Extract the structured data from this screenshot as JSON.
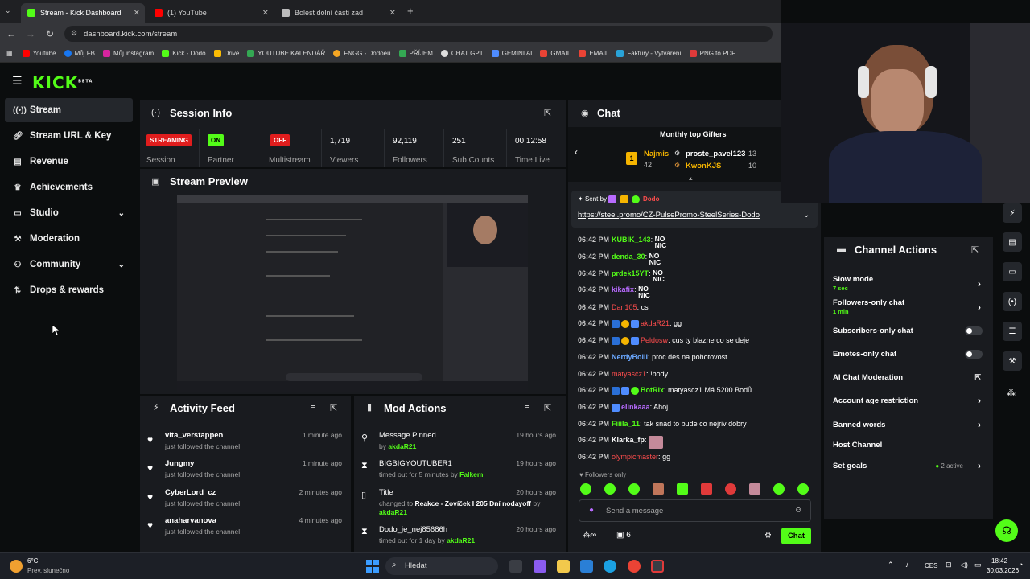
{
  "browser": {
    "tabs": [
      {
        "title": "Stream - Kick Dashboard",
        "active": true
      },
      {
        "title": "(1) YouTube",
        "active": false
      },
      {
        "title": "Bolest dolní části zad",
        "active": false
      }
    ],
    "new_tab": "+",
    "url": "dashboard.kick.com/stream",
    "bookmarks": [
      "Youtube",
      "Můj FB",
      "Můj instagram",
      "Kick - Dodo",
      "Drive",
      "YOUTUBE KALENDÁŘ",
      "FNGG - Dodoeu",
      "PŘÍJEM",
      "CHAT GPT",
      "GEMINI AI",
      "GMAIL",
      "EMAIL",
      "Faktury - Vytváření",
      "PNG to PDF"
    ]
  },
  "kick": {
    "logo": "KICK",
    "logo_sup": "BETA",
    "brand_color": "#53fc18"
  },
  "sidebar": {
    "items": [
      {
        "label": "Stream",
        "icon": "broadcast-icon"
      },
      {
        "label": "Stream URL & Key",
        "icon": "link-icon"
      },
      {
        "label": "Revenue",
        "icon": "chart-icon"
      },
      {
        "label": "Achievements",
        "icon": "trophy-icon"
      },
      {
        "label": "Studio",
        "icon": "monitor-icon"
      },
      {
        "label": "Moderation",
        "icon": "wrench-icon"
      },
      {
        "label": "Community",
        "icon": "people-icon"
      },
      {
        "label": "Drops & rewards",
        "icon": "gift-icon"
      }
    ]
  },
  "session": {
    "title": "Session Info",
    "stats": [
      {
        "badge": "STREAMING",
        "label": "Session"
      },
      {
        "badge": "ON",
        "label": "Partner"
      },
      {
        "badge": "OFF",
        "label": "Multistream"
      },
      {
        "value": "1,719",
        "label": "Viewers"
      },
      {
        "value": "92,119",
        "label": "Followers"
      },
      {
        "value": "251",
        "label": "Sub Counts"
      },
      {
        "value": "00:12:58",
        "label": "Time Live"
      }
    ]
  },
  "preview": {
    "title": "Stream Preview"
  },
  "activity": {
    "title": "Activity Feed",
    "items": [
      {
        "name": "vita_verstappen",
        "sub": "just followed the channel",
        "time": "1 minute ago"
      },
      {
        "name": "Jungmy",
        "sub": "just followed the channel",
        "time": "1 minute ago"
      },
      {
        "name": "CyberLord_cz",
        "sub": "just followed the channel",
        "time": "2 minutes ago"
      },
      {
        "name": "anaharvanova",
        "sub": "just followed the channel",
        "time": "4 minutes ago"
      }
    ]
  },
  "mod": {
    "title": "Mod Actions",
    "items": [
      {
        "name": "Message Pinned",
        "pre": "by",
        "by": "akdaR21",
        "time": "19 hours ago"
      },
      {
        "name": "BIGBIGYOUTUBER1",
        "pre": "timed out for 5 minutes by",
        "by": "Falkem",
        "time": "19 hours ago"
      },
      {
        "name": "Title",
        "pre": "changed to",
        "mid": "Reakce - Zovíček I 205 Dní nodayoff",
        "pre2": "by",
        "by": "akdaR21",
        "time": "20 hours ago"
      },
      {
        "name": "Dodo_je_nej85686h",
        "pre": "timed out for 1 day by",
        "by": "akdaR21",
        "time": "20 hours ago"
      }
    ]
  },
  "chat": {
    "title": "Chat",
    "gifters_title": "Monthly top Gifters",
    "gifters": [
      {
        "rank": "1",
        "name": "Najmis",
        "count": "42"
      },
      {
        "name": "proste_pavel123",
        "count": "13"
      },
      {
        "name": "KwonKJS",
        "count": "10"
      }
    ],
    "pinned_by_label": "Sent by",
    "pinned_by": "Dodo",
    "pinned_link": "https://steel.promo/CZ-PulsePromo-SteelSeries-Dodo",
    "messages": [
      {
        "time": "06:42 PM",
        "user": "KUBIK_143",
        "color": "#53fc18",
        "text": "NO NIC"
      },
      {
        "time": "06:42 PM",
        "user": "denda_30",
        "color": "#53fc18",
        "text": "NO NIC"
      },
      {
        "time": "06:42 PM",
        "user": "prdek15YT",
        "color": "#53fc18",
        "text": "NO NIC"
      },
      {
        "time": "06:42 PM",
        "user": "kikafix",
        "color": "#b86bff",
        "text": "NO NIC"
      },
      {
        "time": "06:42 PM",
        "user": "Dan105",
        "color": "#ff4d4d",
        "text": "cs"
      },
      {
        "time": "06:42 PM",
        "user": "akdaR21",
        "color": "#ff4d4d",
        "text": "gg"
      },
      {
        "time": "06:42 PM",
        "user": "Peldosw",
        "color": "#ff4d4d",
        "text": "cus ty blazne co se deje"
      },
      {
        "time": "06:42 PM",
        "user": "NerdyBoiii",
        "color": "#6ba8ff",
        "text": "proc des na pohotovost"
      },
      {
        "time": "06:42 PM",
        "user": "matyascz1",
        "color": "#ff4d4d",
        "text": "!body"
      },
      {
        "time": "06:42 PM",
        "user": "BotRix",
        "color": "#53fc18",
        "text": "matyascz1 Má 5200 Bodů"
      },
      {
        "time": "06:42 PM",
        "user": "elinkaaa",
        "color": "#b86bff",
        "text": "Ahoj"
      },
      {
        "time": "06:42 PM",
        "user": "Fiiila_11",
        "color": "#53fc18",
        "text": "tak snad to bude co nejriv dobry"
      },
      {
        "time": "06:42 PM",
        "user": "Klarka_fp",
        "color": "#ffffff",
        "text": ""
      },
      {
        "time": "06:42 PM",
        "user": "olympicmaster",
        "color": "#ff4d4d",
        "text": "gg"
      }
    ],
    "followers_only": "Followers only",
    "input_placeholder": "Send a message",
    "count": "6",
    "send_label": "Chat"
  },
  "channel_actions": {
    "title": "Channel Actions",
    "items": [
      {
        "label": "Slow mode",
        "sub": "7 sec",
        "control": "chevron"
      },
      {
        "label": "Followers-only chat",
        "sub": "1 min",
        "control": "chevron"
      },
      {
        "label": "Subscribers-only chat",
        "control": "toggle"
      },
      {
        "label": "Emotes-only chat",
        "control": "toggle"
      },
      {
        "label": "AI Chat Moderation",
        "control": "external"
      },
      {
        "label": "Account age restriction",
        "control": "chevron"
      },
      {
        "label": "Banned words",
        "control": "chevron"
      },
      {
        "label": "Host Channel",
        "control": "none"
      },
      {
        "label": "Set goals",
        "status": "2 active",
        "control": "chevron"
      }
    ]
  },
  "taskbar": {
    "weather_temp": "6°C",
    "weather_desc": "Prev. slunečno",
    "search_placeholder": "Hledat",
    "language": "CES",
    "time": "18:42",
    "date": "30.03.2026"
  }
}
